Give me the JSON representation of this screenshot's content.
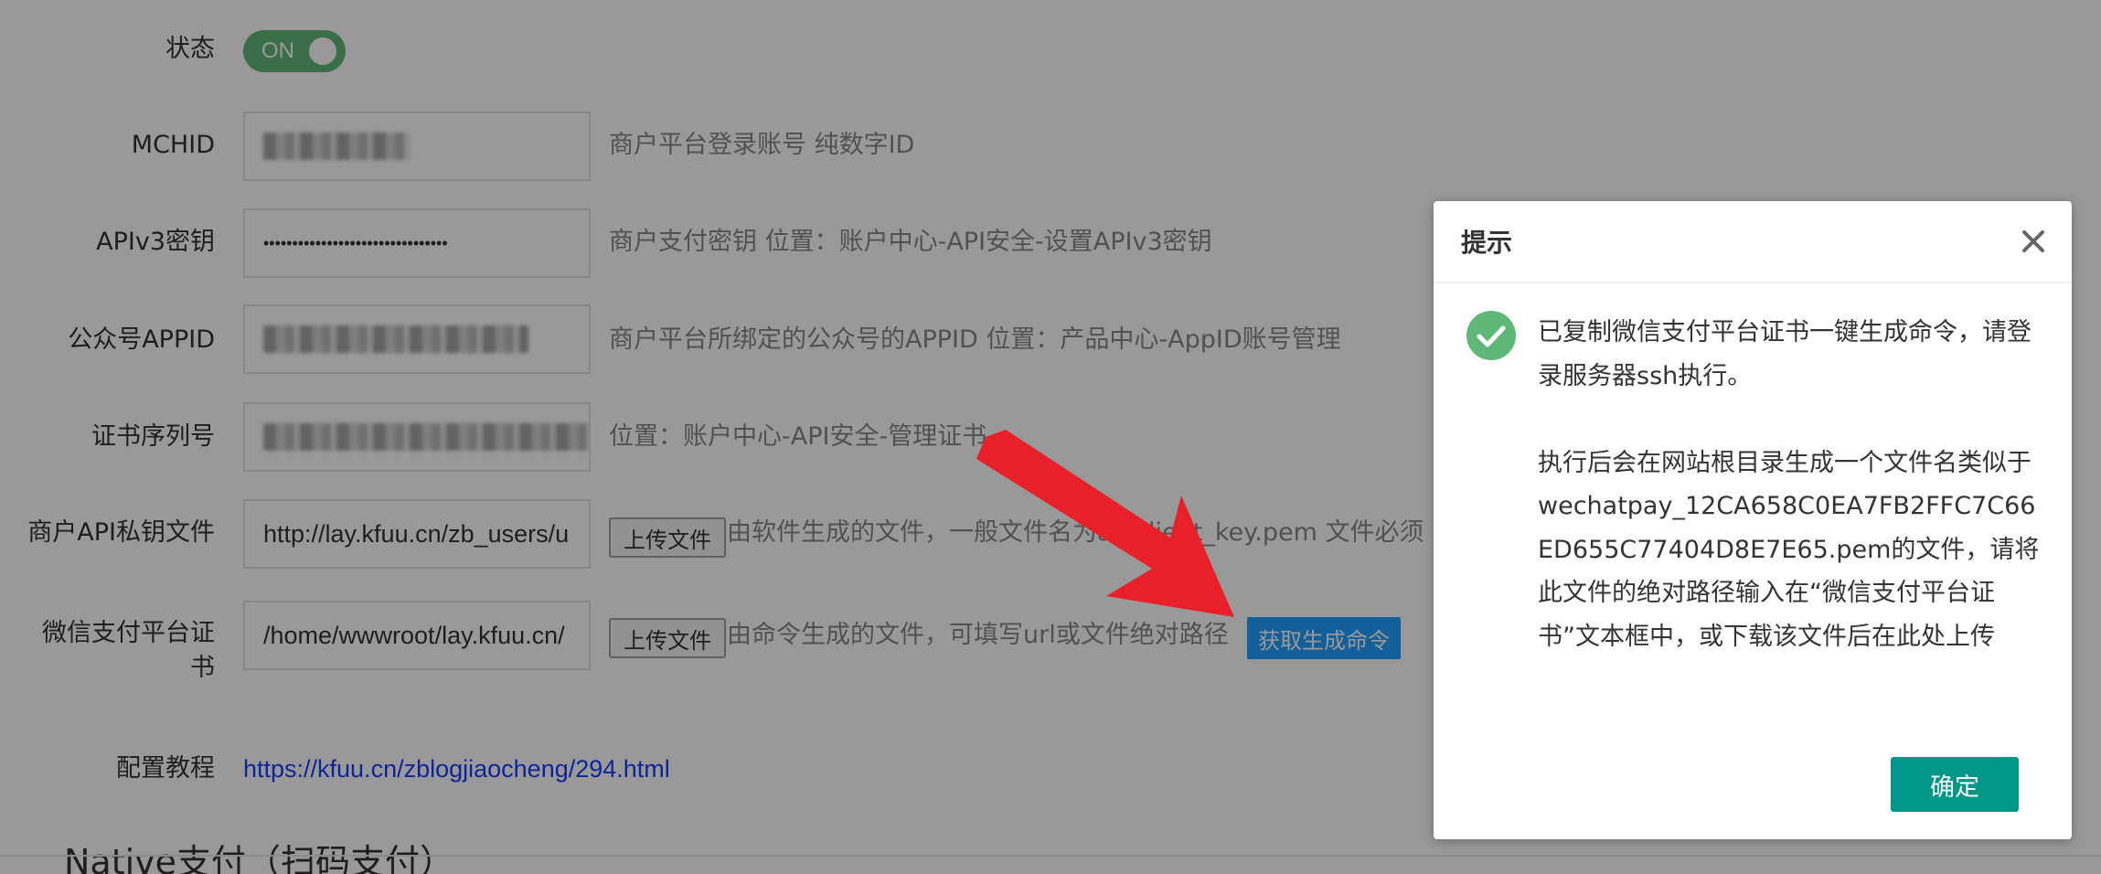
{
  "form": {
    "status": {
      "label": "状态",
      "switch_text": "ON"
    },
    "mchid": {
      "label": "MCHID",
      "hint": "商户平台登录账号 纯数字ID"
    },
    "apiv3": {
      "label": "APIv3密钥",
      "value": "••••••••••••••••••••••••••••••••",
      "hint": "商户支付密钥 位置：账户中心-API安全-设置APIv3密钥"
    },
    "appid": {
      "label": "公众号APPID",
      "hint": "商户平台所绑定的公众号的APPID 位置：产品中心-AppID账号管理"
    },
    "serial": {
      "label": "证书序列号",
      "hint": "位置：账户中心-API安全-管理证书"
    },
    "private_key": {
      "label": "商户API私钥文件",
      "value": "http://lay.kfuu.cn/zb_users/u",
      "upload_label": "上传文件",
      "hint": "由软件生成的文件，一般文件名为apiclient_key.pem 文件必须"
    },
    "platform_cert": {
      "label": "微信支付平台证书",
      "value": "/home/wwwroot/lay.kfuu.cn/",
      "upload_label": "上传文件",
      "hint": "由命令生成的文件，可填写url或文件绝对路径",
      "command_button": "获取生成命令"
    },
    "tutorial": {
      "label": "配置教程",
      "link": "https://kfuu.cn/zblogjiaocheng/294.html"
    }
  },
  "section": {
    "title": "Native支付（扫码支付）"
  },
  "dialog": {
    "title": "提示",
    "message": "已复制微信支付平台证书一键生成命令，请登录服务器ssh执行。\n\n执行后会在网站根目录生成一个文件名类似于wechatpay_12CA658C0EA7FB2FFC7C66ED655C77404D8E7E65.pem的文件，请将此文件的绝对路径输入在“微信支付平台证书”文本框中，或下载该文件后在此处上传",
    "ok_label": "确定"
  },
  "icons": {
    "close": "close-icon",
    "success": "check-circle-icon",
    "arrow": "red-arrow-annotation"
  },
  "colors": {
    "switch_on": "#5fb878",
    "primary_button": "#009688",
    "command_button": "#1e9fff",
    "arrow": "#e8202a",
    "link": "#1a3cff"
  }
}
